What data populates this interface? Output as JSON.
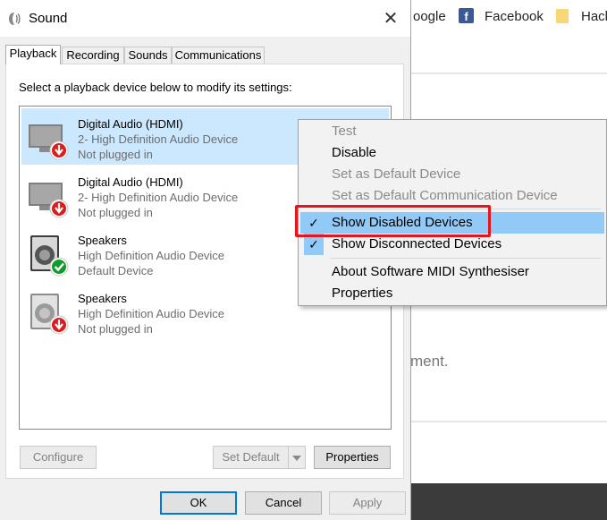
{
  "background": {
    "bookmarks": [
      "oogle",
      "Facebook",
      "Hack"
    ],
    "body_text": "ment."
  },
  "dialog": {
    "title": "Sound",
    "close_symbol": "✕",
    "tabs": [
      {
        "label": "Playback",
        "active": true
      },
      {
        "label": "Recording",
        "active": false
      },
      {
        "label": "Sounds",
        "active": false
      },
      {
        "label": "Communications",
        "active": false
      }
    ],
    "instruction": "Select a playback device below to modify its settings:",
    "devices": [
      {
        "name": "Digital Audio (HDMI)",
        "description": "2- High Definition Audio Device",
        "status": "Not plugged in",
        "icon": "monitor-icon",
        "badge": "red-down-arrow",
        "selected": true
      },
      {
        "name": "Digital Audio (HDMI)",
        "description": "2- High Definition Audio Device",
        "status": "Not plugged in",
        "icon": "monitor-icon",
        "badge": "red-down-arrow",
        "selected": false
      },
      {
        "name": "Speakers",
        "description": "High Definition Audio Device",
        "status": "Default Device",
        "icon": "speaker-icon",
        "badge": "green-check",
        "selected": false
      },
      {
        "name": "Speakers",
        "description": "High Definition Audio Device",
        "status": "Not plugged in",
        "icon": "speaker-icon",
        "badge": "red-down-arrow",
        "selected": false
      }
    ],
    "buttons": {
      "configure": "Configure",
      "set_default": "Set Default",
      "properties": "Properties",
      "ok": "OK",
      "cancel": "Cancel",
      "apply": "Apply"
    }
  },
  "context_menu": {
    "items": [
      {
        "label": "Test",
        "enabled": false,
        "checked": false
      },
      {
        "label": "Disable",
        "enabled": true,
        "checked": false
      },
      {
        "label": "Set as Default Device",
        "enabled": false,
        "checked": false
      },
      {
        "label": "Set as Default Communication Device",
        "enabled": false,
        "checked": false
      },
      {
        "label": "Show Disabled Devices",
        "enabled": true,
        "checked": true,
        "highlighted": true
      },
      {
        "label": "Show Disconnected Devices",
        "enabled": true,
        "checked": true
      },
      {
        "label": "About Software MIDI Synthesiser",
        "enabled": true,
        "checked": false
      },
      {
        "label": "Properties",
        "enabled": true,
        "checked": false
      }
    ],
    "check_symbol": "✓"
  },
  "colors": {
    "selection": "#cce8ff",
    "menu_highlight": "#91c9f7",
    "annotation_red": "#e8141b",
    "accent_blue": "#0078d7"
  }
}
